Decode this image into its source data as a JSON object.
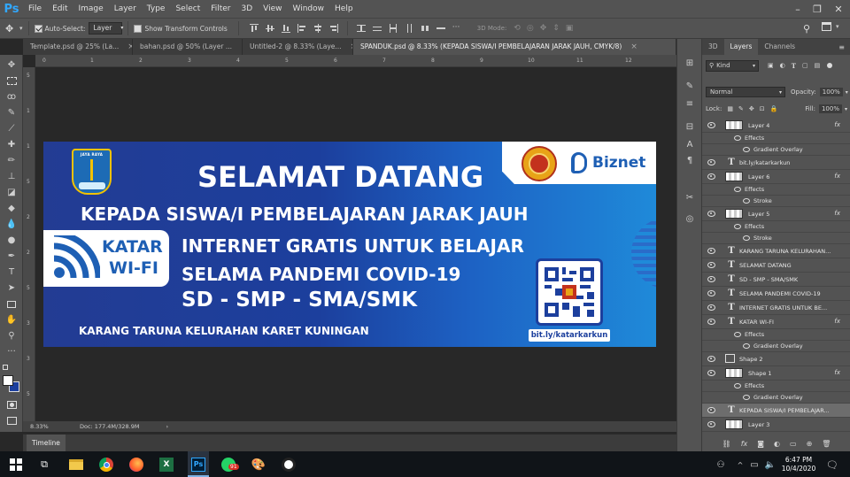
{
  "app": {
    "logo": "Ps"
  },
  "menu": [
    "File",
    "Edit",
    "Image",
    "Layer",
    "Type",
    "Select",
    "Filter",
    "3D",
    "View",
    "Window",
    "Help"
  ],
  "options": {
    "auto_select_label": "Auto-Select:",
    "auto_select_value": "Layer",
    "transform_label": "Show Transform Controls",
    "mode_label": "3D Mode:"
  },
  "tabs": [
    {
      "label": "Template.psd @ 25% (La..."
    },
    {
      "label": "bahan.psd @ 50% (Layer ..."
    },
    {
      "label": "Untitled-2 @ 8.33% (Laye..."
    },
    {
      "label": "SPANDUK.psd @ 8.33% (KEPADA SISWA/I PEMBELAJARAN JARAK JAUH, CMYK/8)"
    }
  ],
  "ruler": {
    "top": [
      "0",
      "1",
      "2",
      "3",
      "4",
      "5",
      "6",
      "7",
      "8",
      "9",
      "10",
      "11",
      "12"
    ],
    "left": [
      "5",
      "1",
      "1",
      "5",
      "2",
      "2",
      "5",
      "3",
      "3",
      "5"
    ]
  },
  "status": {
    "zoom": "8.33%",
    "doc": "Doc: 177.4M/328.9M"
  },
  "timeline": {
    "label": "Timeline"
  },
  "banner": {
    "title": "SELAMAT DATANG",
    "line1": "KEPADA SISWA/I PEMBELAJARAN JARAK JAUH",
    "line2": "INTERNET GRATIS UNTUK BELAJAR",
    "line3": "SELAMA PANDEMI COVID-19",
    "line4": "SD - SMP - SMA/SMK",
    "footer": "KARANG TARUNA KELURAHAN KARET KUNINGAN",
    "wifi_line1": "KATAR",
    "wifi_line2": "WI-FI",
    "brand": "Biznet",
    "link": "bit.ly/katarkarkun",
    "crest_text": "JAYA RAYA"
  },
  "panel": {
    "tabs": [
      "3D",
      "Layers",
      "Channels"
    ],
    "kind_label": "Kind",
    "blend_mode": "Normal",
    "opacity_label": "Opacity:",
    "opacity_value": "100%",
    "lock_label": "Lock:",
    "fill_label": "Fill:",
    "fill_value": "100%",
    "layers": [
      {
        "name": "Layer 4",
        "type": "image",
        "fx": true
      },
      {
        "name": "Effects",
        "type": "effects"
      },
      {
        "name": "Gradient Overlay",
        "type": "effect"
      },
      {
        "name": "bit.ly/katarkarkun",
        "type": "text"
      },
      {
        "name": "Layer 6",
        "type": "image",
        "fx": true
      },
      {
        "name": "Effects",
        "type": "effects"
      },
      {
        "name": "Stroke",
        "type": "effect"
      },
      {
        "name": "Layer 5",
        "type": "image",
        "fx": true
      },
      {
        "name": "Effects",
        "type": "effects"
      },
      {
        "name": "Stroke",
        "type": "effect"
      },
      {
        "name": "KARANG TARUNA KELURAHAN...",
        "type": "text"
      },
      {
        "name": "SELAMAT DATANG",
        "type": "text"
      },
      {
        "name": "SD - SMP - SMA/SMK",
        "type": "text"
      },
      {
        "name": "SELAMA PANDEMI COVID-19",
        "type": "text"
      },
      {
        "name": "INTERNET GRATIS UNTUK BE...",
        "type": "text"
      },
      {
        "name": "KATAR WI-FI",
        "type": "text",
        "fx": true
      },
      {
        "name": "Effects",
        "type": "effects"
      },
      {
        "name": "Gradient Overlay",
        "type": "effect"
      },
      {
        "name": "Shape 2",
        "type": "shape"
      },
      {
        "name": "Shape 1",
        "type": "image",
        "fx": true
      },
      {
        "name": "Effects",
        "type": "effects"
      },
      {
        "name": "Gradient Overlay",
        "type": "effect"
      },
      {
        "name": "KEPADA SISWA/I PEMBELAJAR...",
        "type": "text",
        "active": true
      },
      {
        "name": "Layer 3",
        "type": "image"
      }
    ]
  },
  "taskbar": {
    "time": "6:47 PM",
    "date": "10/4/2020",
    "badge": "91"
  },
  "colors": {
    "ps_blue": "#31a8ff",
    "banner_start": "#233c93",
    "banner_end": "#1f8ad9",
    "brand_blue": "#1e5fb4"
  }
}
